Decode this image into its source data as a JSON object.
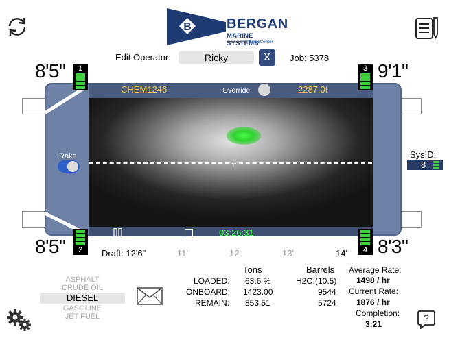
{
  "header": {
    "logo_brand": "BERGAN",
    "logo_sub": "MARINE SYSTEMS",
    "logo_powered_prefix": "POWERED BY",
    "logo_powered_name": "BargeCenter",
    "logo_letter": "B"
  },
  "operator": {
    "label": "Edit Operator:",
    "value": "Ricky",
    "clear_label": "X",
    "job": "Job: 5378"
  },
  "barge": {
    "vessel_id": "CHEM1246",
    "override_label": "Override",
    "tonnage": "2287.0t",
    "rake_label": "Rake",
    "timer": "03:26:31"
  },
  "corners": [
    {
      "sensor": "1",
      "reading": "8'5\""
    },
    {
      "sensor": "2",
      "reading": "8'5\""
    },
    {
      "sensor": "3",
      "reading": "9'1\""
    },
    {
      "sensor": "4",
      "reading": "8'3\""
    }
  ],
  "sysid": {
    "label": "SysID:",
    "value": "8"
  },
  "draft": {
    "label": "Draft: 12'6\"",
    "ticks": [
      "11'",
      "12'",
      "13'",
      "14'"
    ]
  },
  "products": [
    "ASPHALT",
    "CRUDE OIL",
    "DIESEL",
    "GASOLINE",
    "JET FUEL"
  ],
  "selected_product": "DIESEL",
  "stats": {
    "tons_header": "Tons",
    "barrels_header": "Barrels",
    "loaded_label": "LOADED:",
    "onboard_label": "ONBOARD:",
    "remain_label": "REMAIN:",
    "loaded_tons": "63.6 %",
    "onboard_tons": "1423.00",
    "remain_tons": "853.51",
    "h2o_barrels": "H2O:(10.5)",
    "onboard_barrels": "9544",
    "remain_barrels": "5724"
  },
  "rates": {
    "average_label": "Average Rate:",
    "average_value": "1498 / hr",
    "current_label": "Current Rate:",
    "current_value": "1876 / hr",
    "completion_label": "Completion:",
    "completion_value": "3:21"
  },
  "colors": {
    "navy": "#1f3b73",
    "barge": "#6e82a8",
    "accent_yellow": "#f2c94c",
    "sensor_green": "#3ed33e",
    "timer_green": "#43ff43"
  },
  "icons": {
    "refresh": "refresh-icon",
    "notes": "notes-icon",
    "mail": "mail-icon",
    "settings": "settings-icon",
    "help": "help-icon"
  }
}
